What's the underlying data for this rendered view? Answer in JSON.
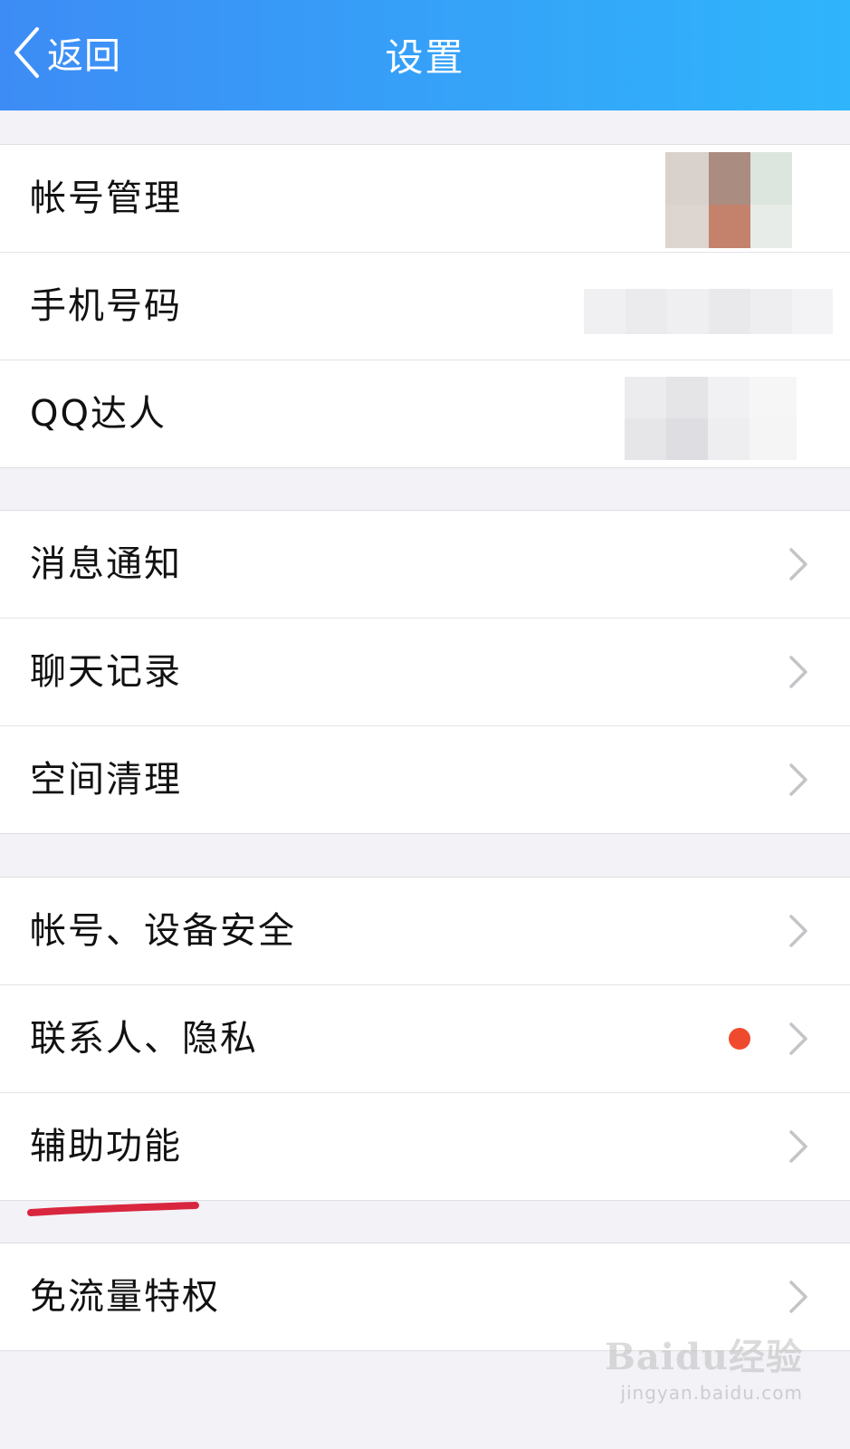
{
  "header": {
    "back_label": "返回",
    "title": "设置",
    "background_from": "#3d8cf5",
    "background_to": "#2fb5fb"
  },
  "group1": [
    {
      "label": "帐号管理",
      "value_obscured": true
    },
    {
      "label": "手机号码",
      "value_obscured": true
    },
    {
      "label": "QQ达人",
      "value_obscured": true
    }
  ],
  "group2": [
    {
      "label": "消息通知",
      "icon": "chevron-right-icon"
    },
    {
      "label": "聊天记录",
      "icon": "chevron-right-icon"
    },
    {
      "label": "空间清理",
      "icon": "chevron-right-icon"
    }
  ],
  "group3": [
    {
      "label": "帐号、设备安全",
      "icon": "chevron-right-icon"
    },
    {
      "label": "联系人、隐私",
      "icon": "chevron-right-icon",
      "badge": "red-dot",
      "badge_color": "#f04a2e"
    },
    {
      "label": "辅助功能",
      "icon": "chevron-right-icon",
      "annotated": true,
      "annotation_color": "#d9263f"
    }
  ],
  "group4": [
    {
      "label": "免流量特权",
      "icon": "chevron-right-icon"
    }
  ],
  "watermark": {
    "brand": "Baidu经验",
    "url": "jingyan.baidu.com"
  }
}
